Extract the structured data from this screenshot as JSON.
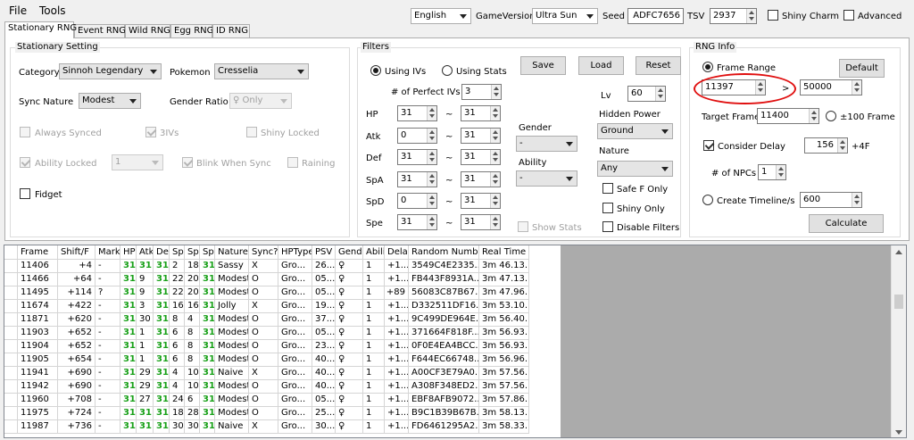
{
  "menu": {
    "file": "File",
    "tools": "Tools"
  },
  "toolbar": {
    "language": "English",
    "game_version_label": "GameVersion",
    "game_version": "Ultra Sun",
    "seed_label": "Seed",
    "seed": "ADFC7656",
    "tsv_label": "TSV",
    "tsv": "2937",
    "shiny_charm": "Shiny Charm",
    "advanced": "Advanced"
  },
  "tabs": [
    "Stationary RNG",
    "Event RNG",
    "Wild RNG",
    "Egg RNG",
    "ID RNG"
  ],
  "stationary": {
    "title": "Stationary Setting",
    "category_label": "Category",
    "category": "Sinnoh Legendary",
    "pokemon_label": "Pokemon",
    "pokemon": "Cresselia",
    "sync_label": "Sync Nature",
    "sync": "Modest",
    "gender_ratio_label": "Gender Ratio",
    "gender_ratio": "♀ Only",
    "always_synced": "Always Synced",
    "three_ivs": "3IVs",
    "shiny_locked": "Shiny Locked",
    "ability_locked": "Ability Locked",
    "ability_value": "1",
    "blink": "Blink When Sync",
    "raining": "Raining",
    "fidget": "Fidget"
  },
  "filters": {
    "title": "Filters",
    "using_ivs": "Using IVs",
    "using_stats": "Using Stats",
    "save": "Save",
    "load": "Load",
    "reset": "Reset",
    "perfect_label": "# of Perfect IVs",
    "perfect": "3",
    "lv_label": "Lv",
    "lv": "60",
    "tilde": "~",
    "stats": [
      {
        "label": "HP",
        "min": "31",
        "max": "31"
      },
      {
        "label": "Atk",
        "min": "0",
        "max": "31"
      },
      {
        "label": "Def",
        "min": "31",
        "max": "31"
      },
      {
        "label": "SpA",
        "min": "31",
        "max": "31"
      },
      {
        "label": "SpD",
        "min": "0",
        "max": "31"
      },
      {
        "label": "Spe",
        "min": "31",
        "max": "31"
      }
    ],
    "gender_label": "Gender",
    "gender": "-",
    "ability_label": "Ability",
    "ability": "-",
    "hidden_power_label": "Hidden Power",
    "hidden_power": "Ground",
    "nature_label": "Nature",
    "nature": "Any",
    "safe_f": "Safe F Only",
    "shiny_only": "Shiny Only",
    "show_stats": "Show Stats",
    "disable_filters": "Disable Filters"
  },
  "rnginfo": {
    "title": "RNG Info",
    "frame_range": "Frame Range",
    "default": "Default",
    "frame_min": "11397",
    "gt": ">",
    "frame_max": "50000",
    "target_label": "Target Frame",
    "target": "11400",
    "pm100": "±100 Frame",
    "consider_delay": "Consider Delay",
    "delay": "156",
    "plus4f": "+4F",
    "npcs_label": "# of NPCs",
    "npcs": "1",
    "timeline": "Create Timeline/s",
    "timeline_val": "600",
    "calculate": "Calculate"
  },
  "table": {
    "headers": [
      "Frame",
      "Shift/F",
      "Mark",
      "HP",
      "Atk",
      "Def",
      "SpA",
      "SpD",
      "Spe",
      "Nature",
      "Sync?",
      "HPType",
      "PSV",
      "Gender",
      "Ability",
      "Delay",
      "Random Number",
      "Real Time"
    ],
    "rows": [
      [
        "11406",
        "+4",
        "-",
        "31",
        "31",
        "31",
        "2",
        "18",
        "31",
        "Sassy",
        "X",
        "Gro...",
        "26...",
        "♀",
        "1",
        "+1...",
        "3549C4E2335...",
        "3m 46.13..."
      ],
      [
        "11466",
        "+64",
        "-",
        "31",
        "9",
        "31",
        "22",
        "20",
        "31",
        "Modest",
        "O",
        "Gro...",
        "05...",
        "♀",
        "1",
        "+1...",
        "FB443F8931A...",
        "3m 47.13..."
      ],
      [
        "11495",
        "+114",
        "?",
        "31",
        "9",
        "31",
        "22",
        "20",
        "31",
        "Modest",
        "O",
        "Gro...",
        "05...",
        "♀",
        "1",
        "+89",
        "56083C87B67...",
        "3m 47.96..."
      ],
      [
        "11674",
        "+422",
        "-",
        "31",
        "3",
        "31",
        "16",
        "16",
        "31",
        "Jolly",
        "X",
        "Gro...",
        "19...",
        "♀",
        "1",
        "+1...",
        "D332511DF16...",
        "3m 53.10..."
      ],
      [
        "11871",
        "+620",
        "-",
        "31",
        "30",
        "31",
        "8",
        "4",
        "31",
        "Modest",
        "O",
        "Gro...",
        "37...",
        "♀",
        "1",
        "+1...",
        "9C499DE964E...",
        "3m 56.40..."
      ],
      [
        "11903",
        "+652",
        "-",
        "31",
        "1",
        "31",
        "6",
        "8",
        "31",
        "Modest",
        "O",
        "Gro...",
        "05...",
        "♀",
        "1",
        "+1...",
        "371664F818F...",
        "3m 56.93..."
      ],
      [
        "11904",
        "+652",
        "-",
        "31",
        "1",
        "31",
        "6",
        "8",
        "31",
        "Modest",
        "O",
        "Gro...",
        "23...",
        "♀",
        "1",
        "+1...",
        "0F0E4EA4BCC...",
        "3m 56.93..."
      ],
      [
        "11905",
        "+654",
        "-",
        "31",
        "1",
        "31",
        "6",
        "8",
        "31",
        "Modest",
        "O",
        "Gro...",
        "40...",
        "♀",
        "1",
        "+1...",
        "F644EC66748...",
        "3m 56.96..."
      ],
      [
        "11941",
        "+690",
        "-",
        "31",
        "29",
        "31",
        "4",
        "10",
        "31",
        "Naive",
        "X",
        "Gro...",
        "40...",
        "♀",
        "1",
        "+1...",
        "A00CF3E79A0...",
        "3m 57.56..."
      ],
      [
        "11942",
        "+690",
        "-",
        "31",
        "29",
        "31",
        "4",
        "10",
        "31",
        "Modest",
        "O",
        "Gro...",
        "40...",
        "♀",
        "1",
        "+1...",
        "A308F348ED2...",
        "3m 57.56..."
      ],
      [
        "11960",
        "+708",
        "-",
        "31",
        "27",
        "31",
        "24",
        "6",
        "31",
        "Modest",
        "O",
        "Gro...",
        "05...",
        "♀",
        "1",
        "+1...",
        "EBF8AFB9072...",
        "3m 57.86..."
      ],
      [
        "11975",
        "+724",
        "-",
        "31",
        "31",
        "31",
        "18",
        "28",
        "31",
        "Modest",
        "O",
        "Gro...",
        "25...",
        "♀",
        "1",
        "+1...",
        "B9C1B39B67B...",
        "3m 58.13..."
      ],
      [
        "11987",
        "+736",
        "-",
        "31",
        "31",
        "31",
        "30",
        "30",
        "31",
        "Naive",
        "X",
        "Gro...",
        "30...",
        "♀",
        "1",
        "+1...",
        "FD6461295A2...",
        "3m 58.33..."
      ]
    ]
  },
  "colors": {
    "accent_green": "#18a018",
    "highlight_circle": "#e01010"
  }
}
